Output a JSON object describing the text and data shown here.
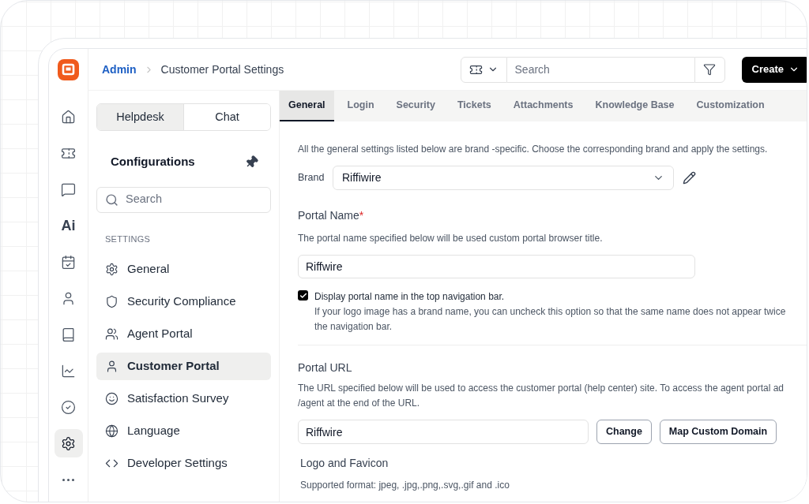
{
  "rail": [
    {
      "kind": "home",
      "selected": false
    },
    {
      "kind": "ticket",
      "selected": false
    },
    {
      "kind": "chat",
      "selected": false
    },
    {
      "kind": "text",
      "label": "Ai",
      "selected": false
    },
    {
      "kind": "calendar",
      "selected": false
    },
    {
      "kind": "user",
      "selected": false
    },
    {
      "kind": "book",
      "selected": false
    },
    {
      "kind": "chart",
      "selected": false
    },
    {
      "kind": "check",
      "selected": false
    },
    {
      "kind": "settings",
      "selected": true
    },
    {
      "kind": "more",
      "selected": false
    }
  ],
  "breadcrumb": {
    "root": "Admin",
    "current": "Customer Portal Settings"
  },
  "search": {
    "placeholder": "Search"
  },
  "create_button": "Create",
  "segments": [
    {
      "label": "Helpdesk",
      "selected": true
    },
    {
      "label": "Chat",
      "selected": false
    }
  ],
  "panel": {
    "title": "Configurations",
    "search_placeholder": "Search",
    "section": "SETTINGS",
    "items": [
      {
        "kind": "gear",
        "label": "General",
        "selected": false
      },
      {
        "kind": "shield",
        "label": "Security Compliance",
        "selected": false
      },
      {
        "kind": "users",
        "label": "Agent Portal",
        "selected": false
      },
      {
        "kind": "user",
        "label": "Customer Portal",
        "selected": true
      },
      {
        "kind": "smile",
        "label": "Satisfaction Survey",
        "selected": false
      },
      {
        "kind": "globe",
        "label": "Language",
        "selected": false
      },
      {
        "kind": "code",
        "label": "Developer Settings",
        "selected": false
      }
    ]
  },
  "tabs": [
    {
      "label": "General",
      "selected": true
    },
    {
      "label": "Login",
      "selected": false
    },
    {
      "label": "Security",
      "selected": false
    },
    {
      "label": "Tickets",
      "selected": false
    },
    {
      "label": "Attachments",
      "selected": false
    },
    {
      "label": "Knowledge Base",
      "selected": false
    },
    {
      "label": "Customization",
      "selected": false
    }
  ],
  "intro": "All the general settings listed below are brand -specific. Choose the corresponding brand and apply the settings.",
  "brand": {
    "label": "Brand",
    "value": "Riffiwire"
  },
  "portal_name": {
    "label": "Portal Name",
    "required_mark": "*",
    "hint": "The portal name specified below will be used custom portal browser title.",
    "value": "Riffwire"
  },
  "display_option": {
    "checked": true,
    "label": "Display portal name in the top navigation bar.",
    "hint_lines": [
      "If your logo image has a brand name, you can uncheck this option so that the same name does not appear twice",
      "the navigation bar."
    ]
  },
  "portal_url": {
    "label": "Portal URL",
    "hint_lines": [
      "The URL specified below will be used to access the customer portal (help center) site. To access the agent portal ad",
      "/agent at the end of the URL."
    ],
    "value": "Riffwire",
    "buttons": [
      "Change",
      "Map Custom Domain"
    ]
  },
  "logo": {
    "label": "Logo and Favicon",
    "hint": "Supported format: jpeg, .jpg,.png,.svg,.gif and .ico"
  }
}
